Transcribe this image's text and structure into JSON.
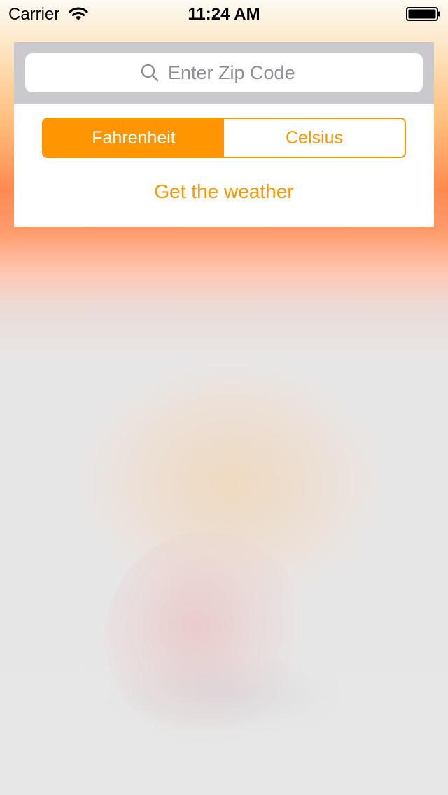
{
  "status_bar": {
    "carrier": "Carrier",
    "time": "11:24 AM",
    "wifi_icon": "wifi-icon",
    "battery_icon": "battery-icon"
  },
  "search": {
    "placeholder": "Enter Zip Code",
    "value": "",
    "icon": "search-icon"
  },
  "units": {
    "options": [
      "Fahrenheit",
      "Celsius"
    ],
    "selected": "Fahrenheit"
  },
  "action": {
    "label": "Get the weather"
  },
  "colors": {
    "accent": "#ff9500",
    "search_bar_bg": "#c9c9ce",
    "placeholder": "#8e8e93"
  }
}
